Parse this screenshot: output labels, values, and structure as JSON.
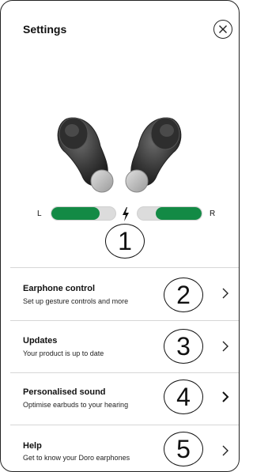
{
  "screen": {
    "title": "Settings"
  },
  "battery": {
    "left_label": "L",
    "right_label": "R",
    "left_level": 0.75,
    "right_level": 0.72,
    "fill_color": "#138a45",
    "empty_color": "#dcdcdc"
  },
  "markers": [
    "1",
    "2",
    "3",
    "4",
    "5"
  ],
  "menu": [
    {
      "title": "Earphone control",
      "subtitle": "Set up gesture controls and more"
    },
    {
      "title": "Updates",
      "subtitle": "Your product is up to date"
    },
    {
      "title": "Personalised sound",
      "subtitle": "Optimise earbuds to your hearing"
    },
    {
      "title": "Help",
      "subtitle": "Get to know your Doro earphones"
    }
  ],
  "icons": {
    "close": "close-icon",
    "charging": "lightning-bolt-icon",
    "chevron": "chevron-right-icon"
  }
}
